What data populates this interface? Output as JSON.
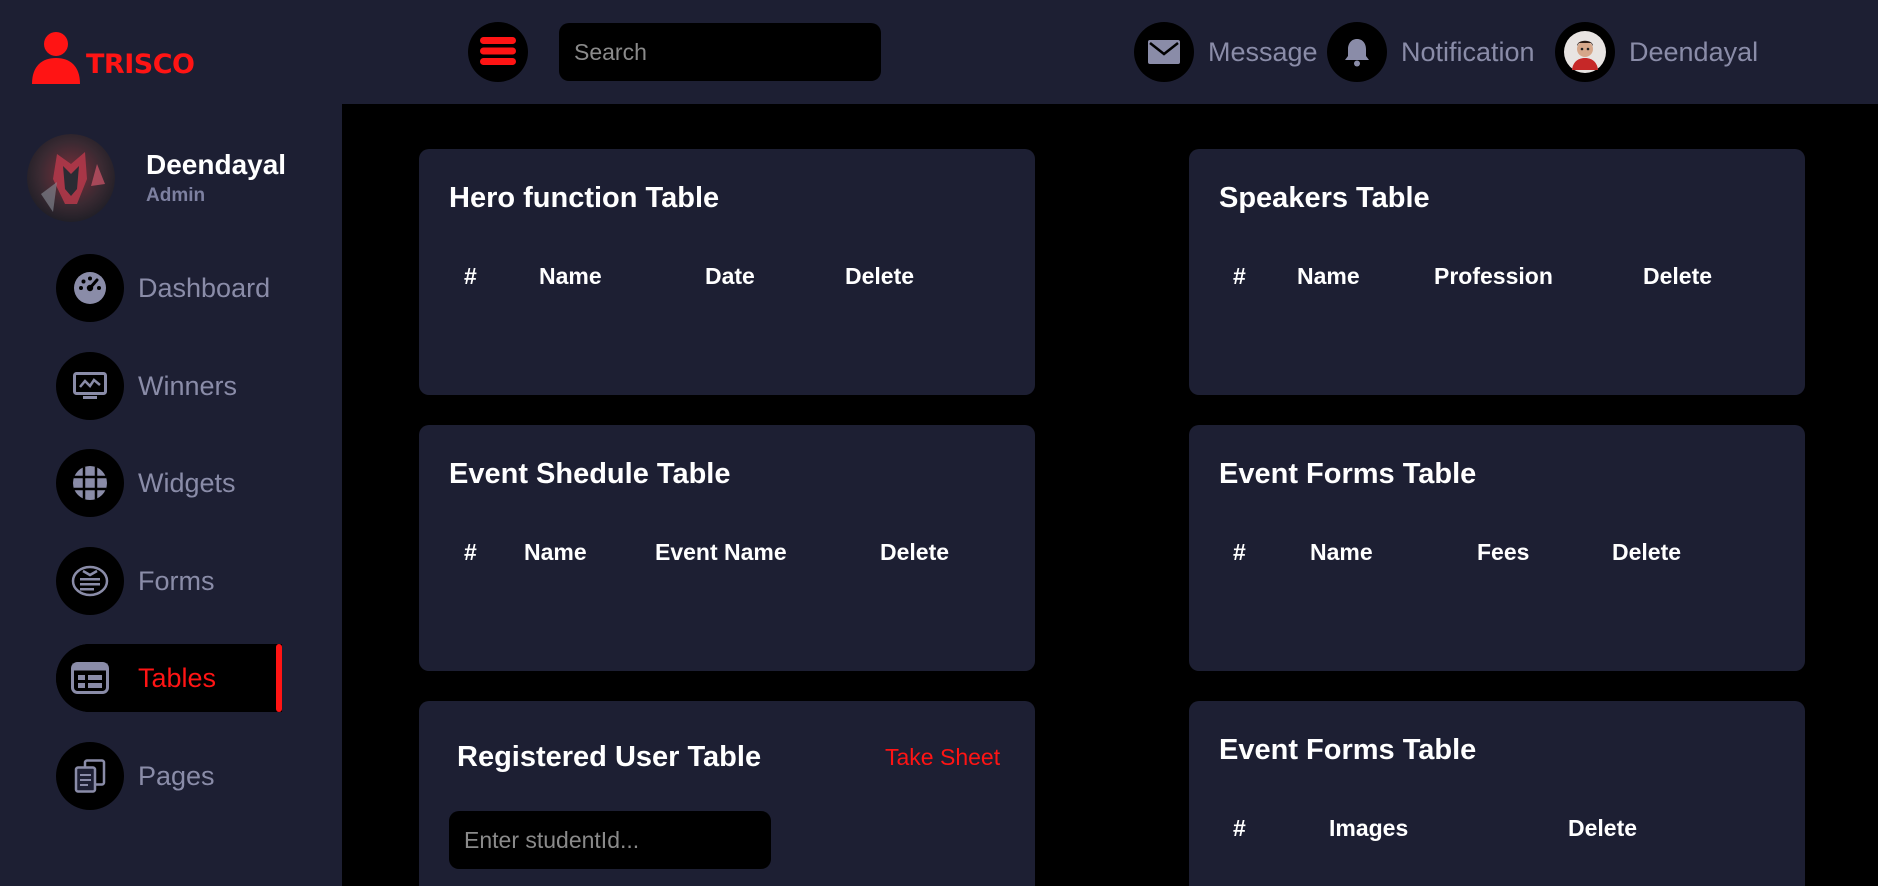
{
  "header": {
    "brand": "TRISCO",
    "search_placeholder": "Search",
    "message_label": "Message",
    "notification_label": "Notification",
    "user_label": "Deendayal"
  },
  "sidebar": {
    "profile_name": "Deendayal",
    "profile_role": "Admin",
    "items": [
      {
        "label": "Dashboard",
        "icon": "gauge-icon"
      },
      {
        "label": "Winners",
        "icon": "monitor-chart-icon"
      },
      {
        "label": "Widgets",
        "icon": "grid-icon"
      },
      {
        "label": "Forms",
        "icon": "form-icon"
      },
      {
        "label": "Tables",
        "icon": "table-icon",
        "active": true
      },
      {
        "label": "Pages",
        "icon": "copy-icon"
      }
    ]
  },
  "cards": {
    "hero": {
      "title": "Hero function Table",
      "headers": [
        "#",
        "Name",
        "Date",
        "Delete"
      ]
    },
    "speakers": {
      "title": "Speakers Table",
      "headers": [
        "#",
        "Name",
        "Profession",
        "Delete"
      ]
    },
    "schedule": {
      "title": "Event Shedule Table",
      "headers": [
        "#",
        "Name",
        "Event Name",
        "Delete"
      ]
    },
    "forms": {
      "title": "Event Forms Table",
      "headers": [
        "#",
        "Name",
        "Fees",
        "Delete"
      ]
    },
    "registered": {
      "title": "Registered User Table",
      "action": "Take Sheet",
      "input_placeholder": "Enter studentId..."
    },
    "forms_images": {
      "title": "Event Forms Table",
      "headers": [
        "#",
        "Images",
        "Delete"
      ]
    }
  },
  "colors": {
    "accent": "#ff1414",
    "panel": "#1d1f33",
    "background": "#000000",
    "muted_text": "#8a8ca8"
  }
}
